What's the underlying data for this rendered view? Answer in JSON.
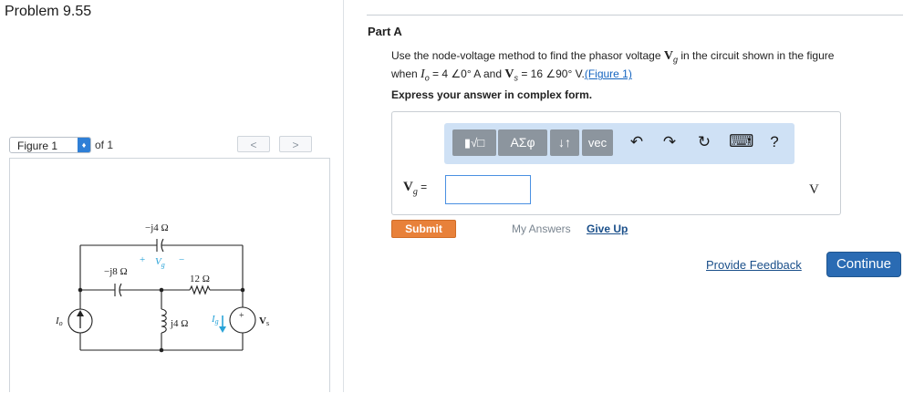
{
  "problem": {
    "title": "Problem 9.55"
  },
  "figure_nav": {
    "selected": "Figure 1",
    "of_text": "of 1",
    "prev": "<",
    "next": ">"
  },
  "circuit": {
    "labels": {
      "top_capacitor": "−j4 Ω",
      "vg_plus": "+",
      "vg_label": "V",
      "vg_sub": "g",
      "vg_minus": "−",
      "left_capacitor": "−j8 Ω",
      "resistor": "12 Ω",
      "inductor": "j4 Ω",
      "current_source": "I",
      "current_source_sub": "o",
      "branch_current": "I",
      "branch_current_sub": "g",
      "voltage_source_plus": "+",
      "voltage_source": "V",
      "voltage_source_sub": "s"
    },
    "accent": "#29a3d8"
  },
  "part": {
    "title": "Part A"
  },
  "question": {
    "text1": "Use the node-voltage method to find the phasor voltage ",
    "vg": "V",
    "vg_sub": "g",
    "text2": " in the circuit shown in the figure",
    "text3": "when ",
    "io": "I",
    "io_sub": "o",
    "io_value": " = 4 ∠0° A",
    "and": " and ",
    "vs": "V",
    "vs_sub": "s",
    "vs_value": " = 16 ∠90° V.",
    "figure_link": "(Figure 1)"
  },
  "instruction": "Express your answer in complex form.",
  "toolbar": {
    "templates": "▮√□",
    "greek": "ΑΣφ",
    "arrows": "↓↑",
    "vec": "vec",
    "undo": "↶",
    "redo": "↷",
    "reset": "↻",
    "keyboard": "⌨",
    "help": "?"
  },
  "answer": {
    "label": "V",
    "label_sub": "g",
    "equals": " =",
    "value": "",
    "unit": "V"
  },
  "buttons": {
    "submit": "Submit",
    "my_answers": "My Answers",
    "give_up": "Give Up",
    "feedback": "Provide Feedback",
    "continue": "Continue"
  },
  "colors": {
    "submit": "#e8813a",
    "continue": "#2a6bb3",
    "link": "#1565c0",
    "toolbar_bg": "#cfe1f5"
  }
}
